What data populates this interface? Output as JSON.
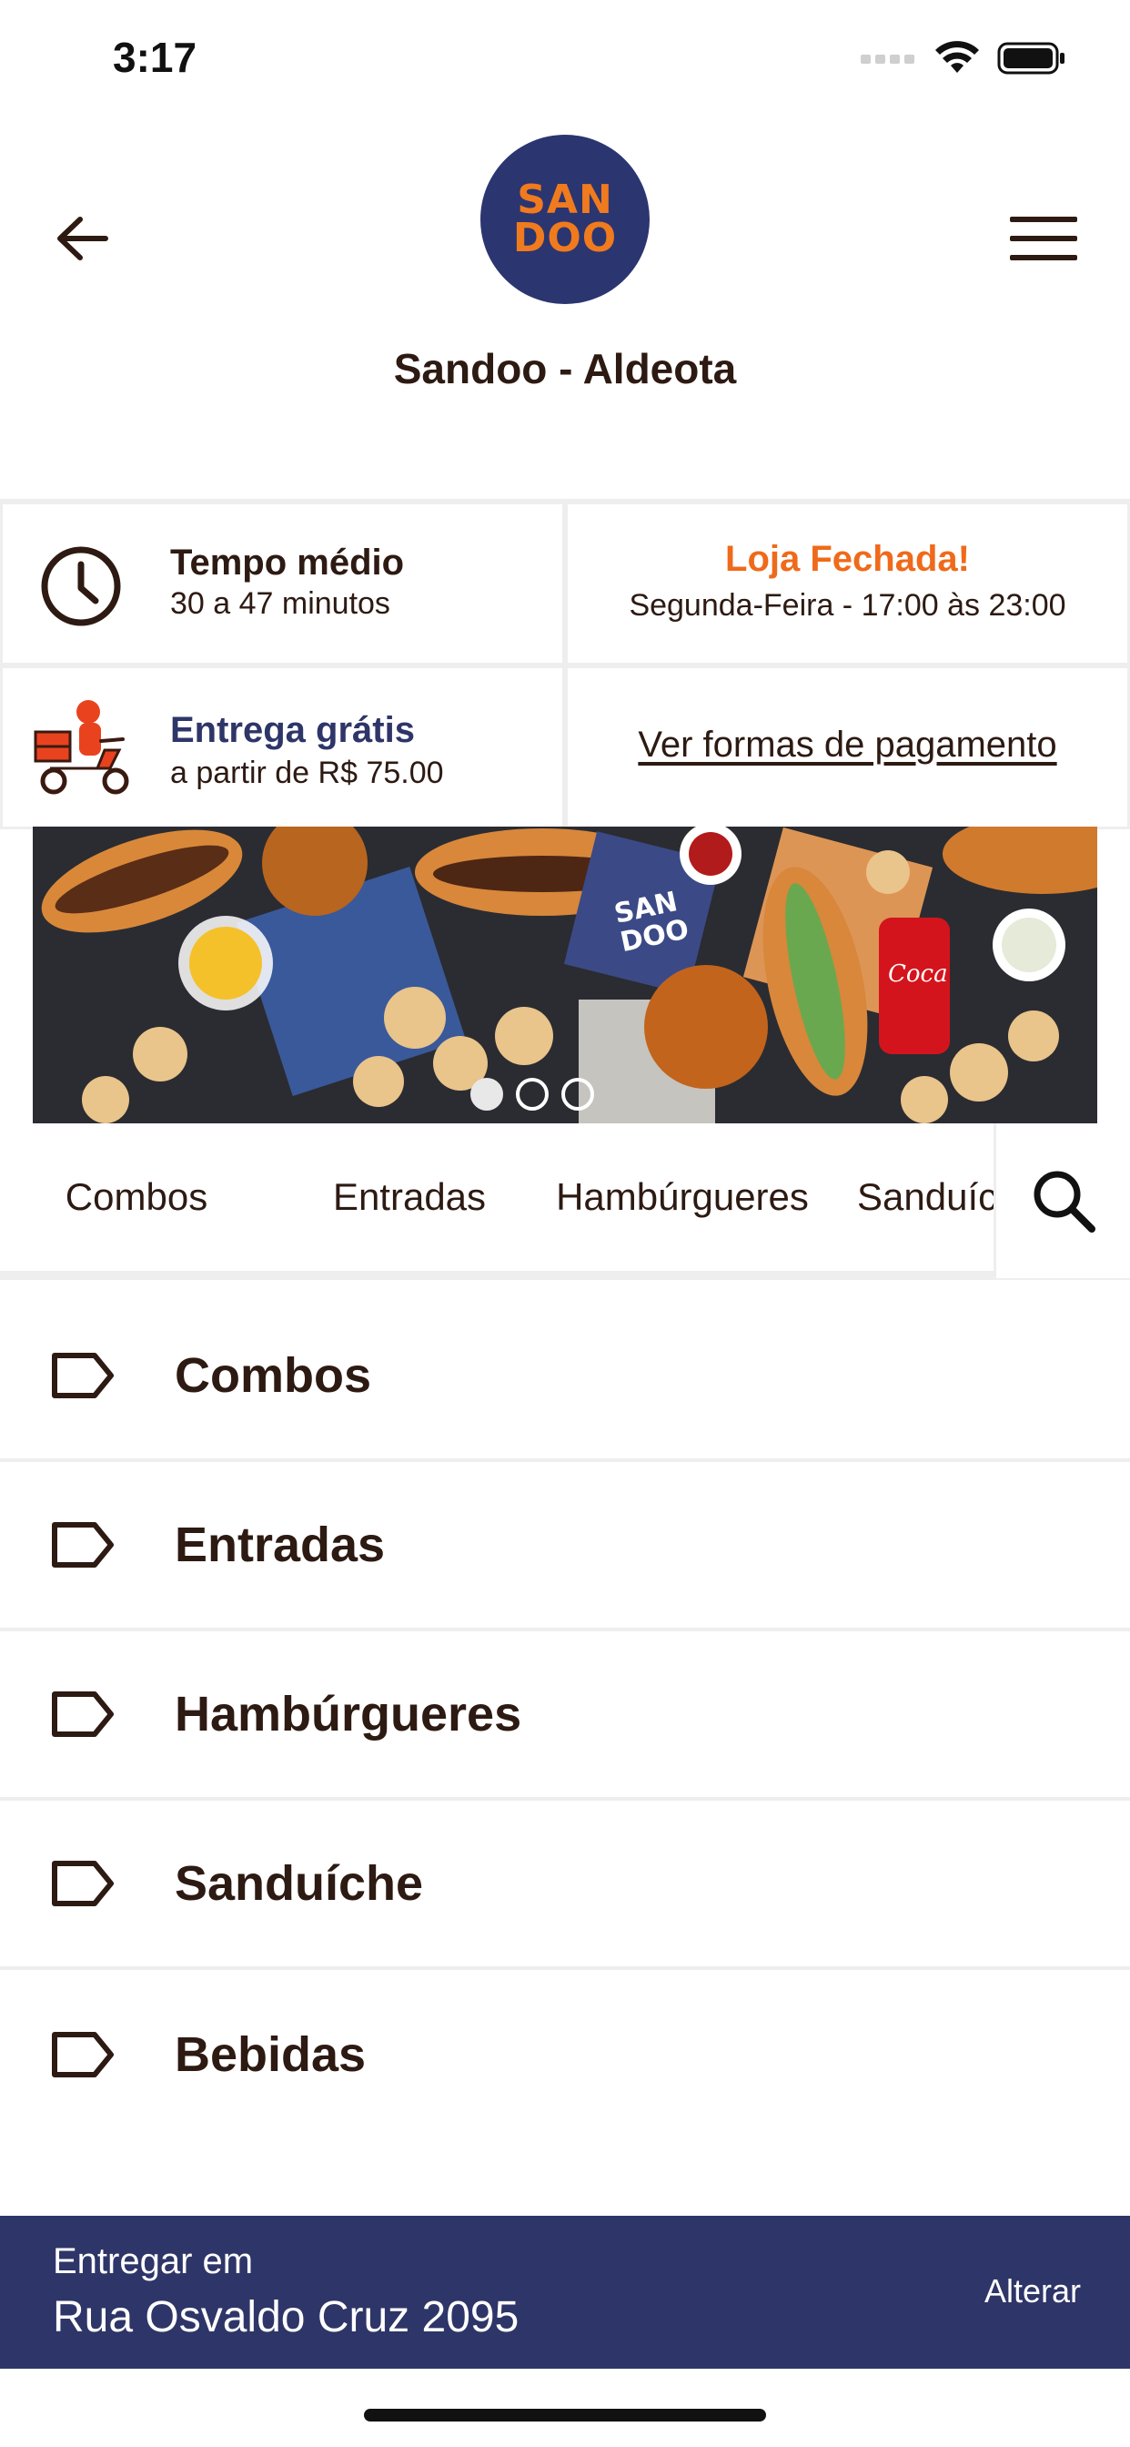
{
  "status_bar": {
    "time": "3:17"
  },
  "header": {
    "store_name": "Sandoo - Aldeota",
    "logo_line1": "SAN",
    "logo_line2": "DOO"
  },
  "info": {
    "avg_time_title": "Tempo médio",
    "avg_time_value": "30 a 47 minutos",
    "store_status": "Loja Fechada!",
    "store_hours": "Segunda-Feira - 17:00 às 23:00",
    "delivery_title": "Entrega grátis",
    "delivery_min": "a partir de R$ 75.00",
    "payment_link": "Ver formas de pagamento"
  },
  "carousel": {
    "slides": 3,
    "active_index": 0
  },
  "tabs": [
    "Combos",
    "Entradas",
    "Hambúrgueres",
    "Sanduíche"
  ],
  "categories": [
    "Combos",
    "Entradas",
    "Hambúrgueres",
    "Sanduíche",
    "Bebidas"
  ],
  "delivery_bar": {
    "label": "Entregar em",
    "address": "Rua Osvaldo Cruz 2095",
    "change": "Alterar"
  },
  "colors": {
    "brand_navy": "#2e3568",
    "brand_orange": "#f07a1e",
    "closed_status": "#ef6a1a",
    "text_dark": "#2d1a12"
  }
}
